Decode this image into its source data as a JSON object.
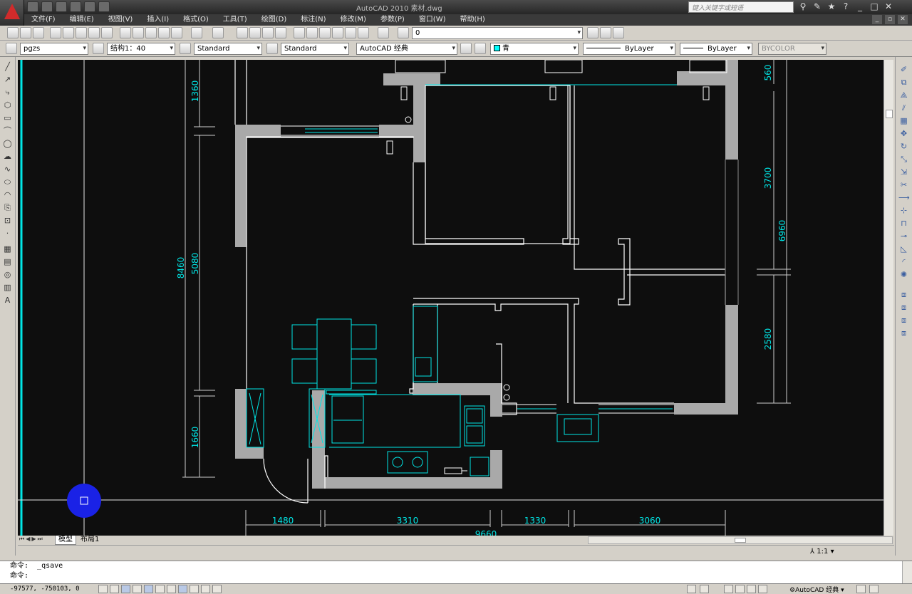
{
  "window": {
    "title": "AutoCAD 2010    素材.dwg",
    "search_placeholder": "键入关键字或短语"
  },
  "menu": [
    "文件(F)",
    "编辑(E)",
    "视图(V)",
    "插入(I)",
    "格式(O)",
    "工具(T)",
    "绘图(D)",
    "标注(N)",
    "修改(M)",
    "参数(P)",
    "窗口(W)",
    "帮助(H)"
  ],
  "toolbar": {
    "layer_value": "0",
    "text_style": "pgzs",
    "dim_style": "结构1：40",
    "table_style": "Standard",
    "mleader_style": "Standard",
    "workspace": "AutoCAD 经典",
    "color_value": "青",
    "linetype_value": "ByLayer",
    "lineweight_value": "ByLayer",
    "plotstyle_value": "BYCOLOR",
    "accent_cyan": "#00ffff"
  },
  "drawing": {
    "dims_left": [
      "1360",
      "5080",
      "8460",
      "1660"
    ],
    "dims_right": [
      "560",
      "3700",
      "6960",
      "2580"
    ],
    "dims_bottom": [
      "1480",
      "3310",
      "1330",
      "3060",
      "9660"
    ],
    "wall_color": "#a9a9a9",
    "line_color": "#ffffff",
    "dim_text_color": "#00e6e6"
  },
  "layout_tabs": {
    "model": "模型",
    "layout1": "布局1"
  },
  "annotation": {
    "scale": "1:1"
  },
  "command": {
    "history": "命令:  _qsave",
    "prompt": "命令:"
  },
  "status": {
    "coords": "-97577, -750103, 0",
    "workspace": "AutoCAD 经典"
  }
}
